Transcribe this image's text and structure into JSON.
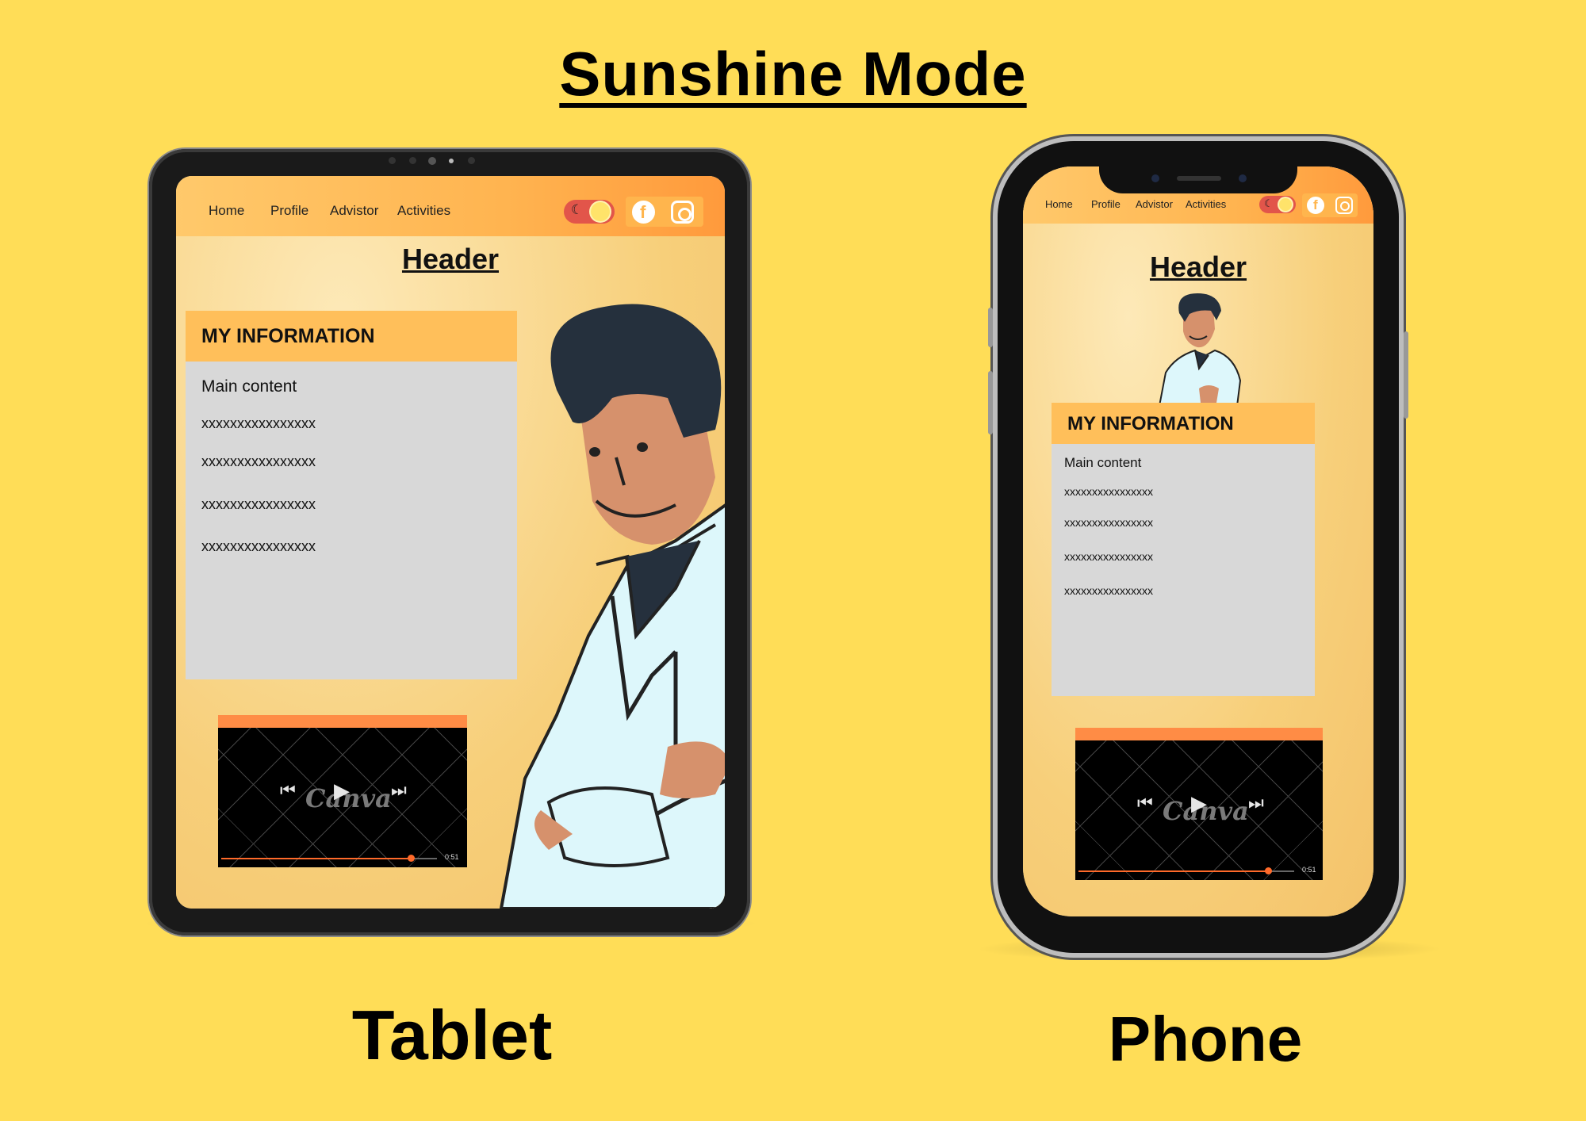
{
  "title": "Sunshine Mode",
  "devices": {
    "tablet_label": "Tablet",
    "phone_label": "Phone"
  },
  "screen": {
    "nav": [
      "Home",
      "Profile",
      "Advistor",
      "Activities"
    ],
    "header": "Header",
    "info_title": "MY INFORMATION",
    "main_content": "Main content",
    "lines": [
      "xxxxxxxxxxxxxxxx",
      "xxxxxxxxxxxxxxxx",
      "xxxxxxxxxxxxxxxx",
      "xxxxxxxxxxxxxxxx"
    ],
    "video": {
      "brand": "Canva",
      "time": "0:51",
      "progress": 0.88
    },
    "icons": [
      "moon-icon",
      "sun-icon",
      "facebook-icon",
      "instagram-icon",
      "previous-icon",
      "play-icon",
      "next-icon"
    ]
  },
  "colors": {
    "background": "#ffdd57",
    "nav": "#ffb450",
    "panel_header": "#ffbf5a",
    "panel": "#d8d8d8",
    "video_bar": "#ff8c45",
    "toggle": "#e2554a"
  }
}
